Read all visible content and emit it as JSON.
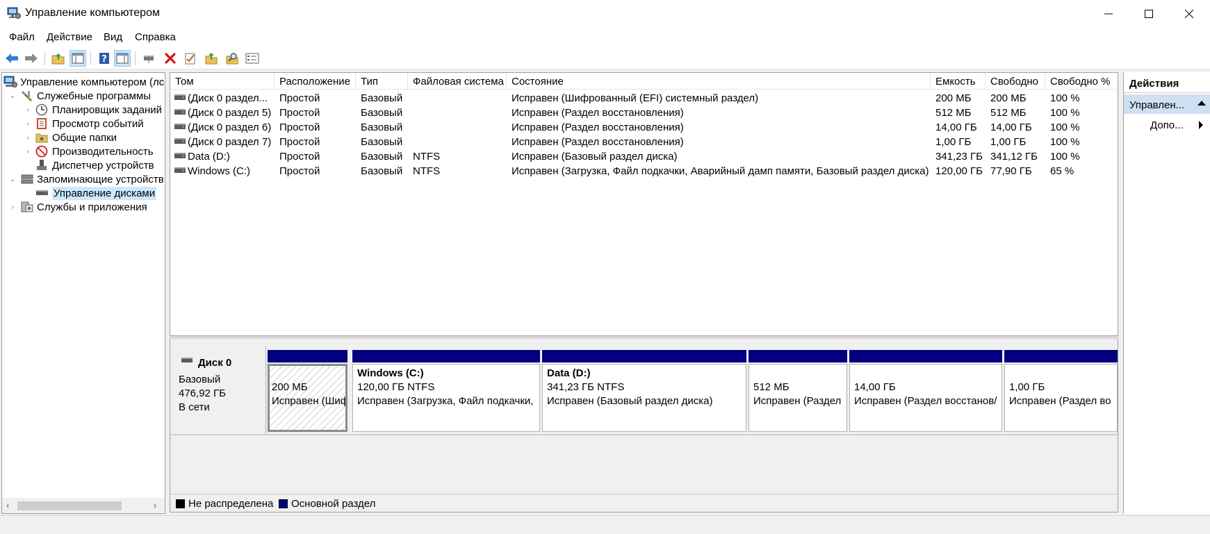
{
  "window": {
    "title": "Управление компьютером"
  },
  "menu": {
    "file": "Файл",
    "action": "Действие",
    "view": "Вид",
    "help": "Справка"
  },
  "tree": {
    "root": "Управление компьютером (лс",
    "system_tools": "Служебные программы",
    "task_scheduler": "Планировщик заданий",
    "event_viewer": "Просмотр событий",
    "shared_folders": "Общие папки",
    "performance": "Производительность",
    "device_manager": "Диспетчер устройств",
    "storage": "Запоминающие устройств",
    "disk_management": "Управление дисками",
    "services_apps": "Службы и приложения"
  },
  "volume_list": {
    "columns": [
      "Том",
      "Расположение",
      "Тип",
      "Файловая система",
      "Состояние",
      "Емкость",
      "Свободно",
      "Свободно %"
    ],
    "rows": [
      {
        "volume": "(Диск 0 раздел...",
        "layout": "Простой",
        "type": "Базовый",
        "fs": "",
        "status": "Исправен (Шифрованный (EFI) системный раздел)",
        "capacity": "200 МБ",
        "free": "200 МБ",
        "pct": "100 %"
      },
      {
        "volume": "(Диск 0 раздел 5)",
        "layout": "Простой",
        "type": "Базовый",
        "fs": "",
        "status": "Исправен (Раздел восстановления)",
        "capacity": "512 МБ",
        "free": "512 МБ",
        "pct": "100 %"
      },
      {
        "volume": "(Диск 0 раздел 6)",
        "layout": "Простой",
        "type": "Базовый",
        "fs": "",
        "status": "Исправен (Раздел восстановления)",
        "capacity": "14,00 ГБ",
        "free": "14,00 ГБ",
        "pct": "100 %"
      },
      {
        "volume": "(Диск 0 раздел 7)",
        "layout": "Простой",
        "type": "Базовый",
        "fs": "",
        "status": "Исправен (Раздел восстановления)",
        "capacity": "1,00 ГБ",
        "free": "1,00 ГБ",
        "pct": "100 %"
      },
      {
        "volume": "Data (D:)",
        "layout": "Простой",
        "type": "Базовый",
        "fs": "NTFS",
        "status": "Исправен (Базовый раздел диска)",
        "capacity": "341,23 ГБ",
        "free": "341,12 ГБ",
        "pct": "100 %"
      },
      {
        "volume": "Windows (C:)",
        "layout": "Простой",
        "type": "Базовый",
        "fs": "NTFS",
        "status": "Исправен (Загрузка, Файл подкачки, Аварийный дамп памяти, Базовый раздел диска)",
        "capacity": "120,00 ГБ",
        "free": "77,90 ГБ",
        "pct": "65 %"
      }
    ]
  },
  "disk": {
    "name": "Диск 0",
    "type": "Базовый",
    "size": "476,92 ГБ",
    "state": "В сети",
    "partitions": [
      {
        "name": "",
        "size": "200 МБ",
        "status": "Исправен (Шиф"
      },
      {
        "name": "Windows  (C:)",
        "size": "120,00 ГБ NTFS",
        "status": "Исправен (Загрузка, Файл подкачки,"
      },
      {
        "name": "Data  (D:)",
        "size": "341,23 ГБ NTFS",
        "status": "Исправен (Базовый раздел диска)"
      },
      {
        "name": "",
        "size": "512 МБ",
        "status": "Исправен (Раздел"
      },
      {
        "name": "",
        "size": "14,00 ГБ",
        "status": "Исправен (Раздел восстанов/"
      },
      {
        "name": "",
        "size": "1,00 ГБ",
        "status": "Исправен (Раздел во"
      }
    ]
  },
  "legend": {
    "unallocated": "Не распределена",
    "primary": "Основной раздел"
  },
  "colors": {
    "unallocated": "#000000",
    "primary": "#000080",
    "selection": "#cce8ff"
  },
  "actions": {
    "header": "Действия",
    "section": "Управлен...",
    "more": "Допо..."
  }
}
